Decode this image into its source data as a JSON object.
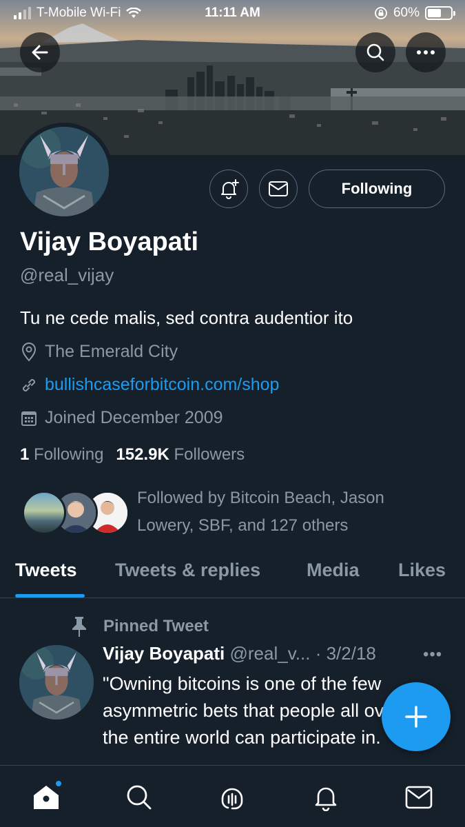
{
  "status_bar": {
    "carrier": "T-Mobile Wi-Fi",
    "time": "11:11 AM",
    "battery": "60%",
    "battery_level": 0.6
  },
  "header": {
    "back_icon": "arrow-left-icon",
    "search_icon": "search-icon",
    "more_icon": "more-icon"
  },
  "profile": {
    "name": "Vijay Boyapati",
    "handle": "@real_vijay",
    "bio": "Tu ne cede malis, sed contra audentior ito",
    "location": "The Emerald City",
    "website": "bullishcaseforbitcoin.com/shop",
    "joined": "Joined December 2009",
    "following_count": "1",
    "following_label": "Following",
    "followers_count": "152.9K",
    "followers_label": "Followers",
    "followed_by_line1": "Followed by Bitcoin Beach, Jason",
    "followed_by_line2": "Lowery, SBF, and 127 others",
    "following_button": "Following"
  },
  "tabs": [
    {
      "label": "Tweets",
      "active": true
    },
    {
      "label": "Tweets & replies",
      "active": false
    },
    {
      "label": "Media",
      "active": false
    },
    {
      "label": "Likes",
      "active": false
    }
  ],
  "pinned_tweet": {
    "pinned_label": "Pinned Tweet",
    "author": "Vijay Boyapati",
    "handle": "@real_v...",
    "separator": "·",
    "date": "3/2/18",
    "more": "•••",
    "line1": "\"Owning bitcoins is one of the few",
    "line2": "asymmetric bets that people all over",
    "line3": "the entire world can participate in."
  },
  "colors": {
    "background": "#15202b",
    "accent": "#1d9bf0",
    "secondary_text": "#8b98a5",
    "border": "#38444d"
  }
}
